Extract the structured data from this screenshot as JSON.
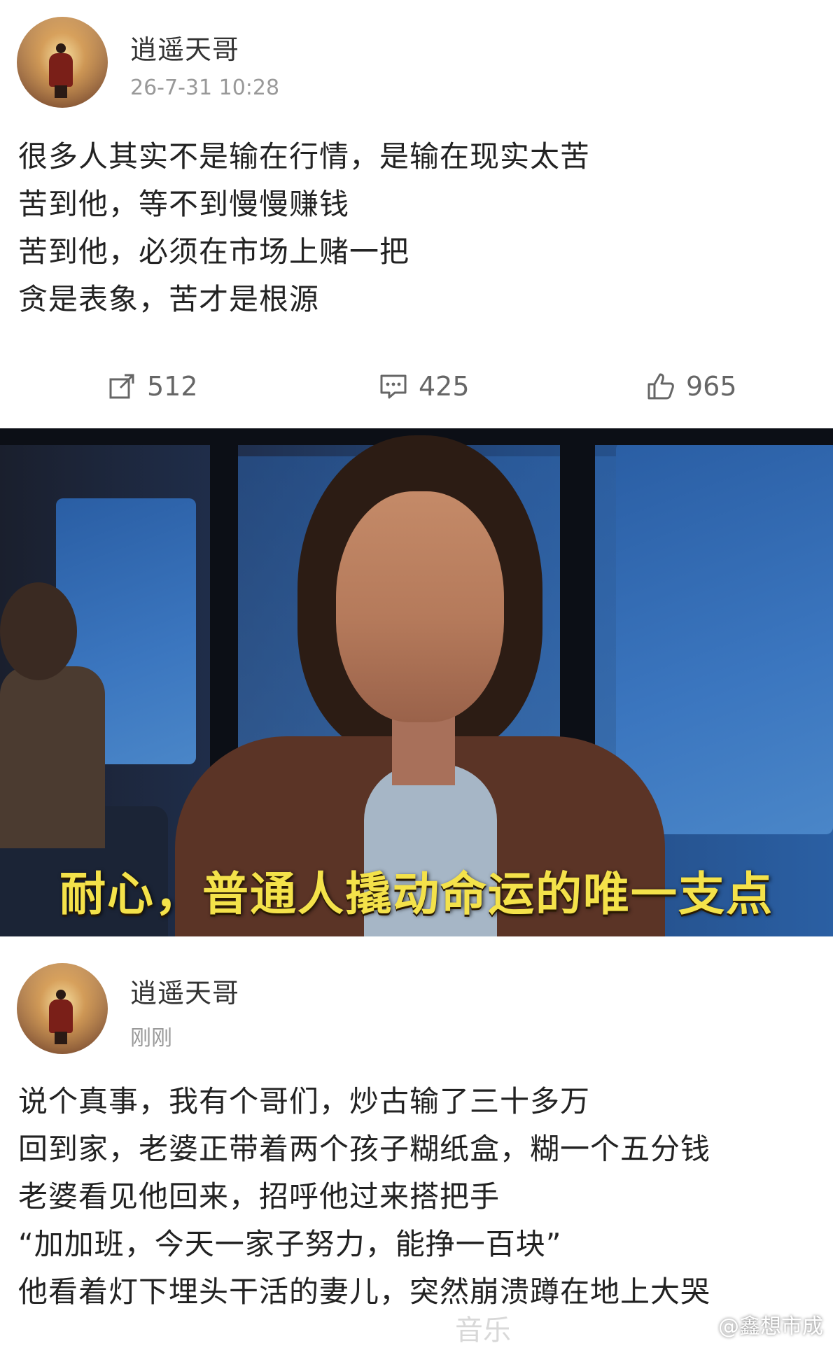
{
  "posts": [
    {
      "username": "逍遥天哥",
      "time": "26-7-31 10:28",
      "lines": [
        "很多人其实不是输在行情，是输在现实太苦",
        "苦到他，等不到慢慢赚钱",
        "苦到他，必须在市场上赌一把",
        "贪是表象，苦才是根源"
      ],
      "actions": {
        "share_count": "512",
        "comment_count": "425",
        "like_count": "965"
      }
    },
    {
      "username": "逍遥天哥",
      "time": "刚刚",
      "lines": [
        "说个真事，我有个哥们，炒古输了三十多万",
        "回到家，老婆正带着两个孩子糊纸盒，糊一个五分钱",
        "老婆看见他回来，招呼他过来搭把手",
        "“加加班，今天一家子努力，能挣一百块”",
        "他看着灯下埋头干活的妻儿，突然崩溃蹲在地上大哭"
      ]
    }
  ],
  "video": {
    "subtitle": "耐心，普通人撬动命运的唯一支点"
  },
  "overlay": {
    "watermark": "@鑫想市成",
    "music_label": "音乐"
  },
  "icons": {
    "share": "share-icon",
    "comment": "comment-icon",
    "like": "thumbs-up-icon",
    "weibo": "weibo-logo-icon"
  }
}
